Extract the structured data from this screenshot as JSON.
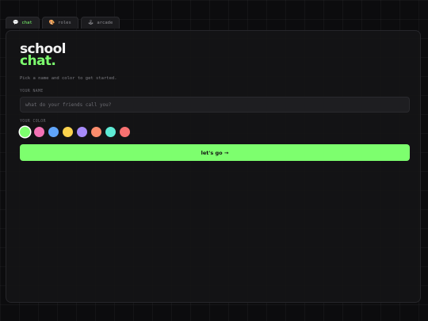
{
  "tabs": [
    {
      "icon": "💬",
      "icon_name": "speech-bubble-icon",
      "label": "chat",
      "active": true
    },
    {
      "icon": "🎨",
      "icon_name": "palette-icon",
      "label": "roles",
      "active": false
    },
    {
      "icon": "🕹",
      "icon_name": "joystick-icon",
      "label": "arcade",
      "active": false
    }
  ],
  "main": {
    "title_line1": "school",
    "title_line2": "chat.",
    "subtitle": "Pick a name and color to get started.",
    "name_label": "YOUR NAME",
    "name_placeholder": "what do your friends call you?",
    "name_value": "",
    "color_label": "YOUR COLOR",
    "colors": [
      "#7dff6e",
      "#f472b6",
      "#60a5fa",
      "#fcd34d",
      "#a78bfa",
      "#fb8c6c",
      "#5eead4",
      "#f87171"
    ],
    "selected_color_index": 0,
    "button_label": "let's go →"
  },
  "theme": {
    "accent": "#7dff6e",
    "background": "#0c0c0e",
    "panel": "#141416"
  }
}
